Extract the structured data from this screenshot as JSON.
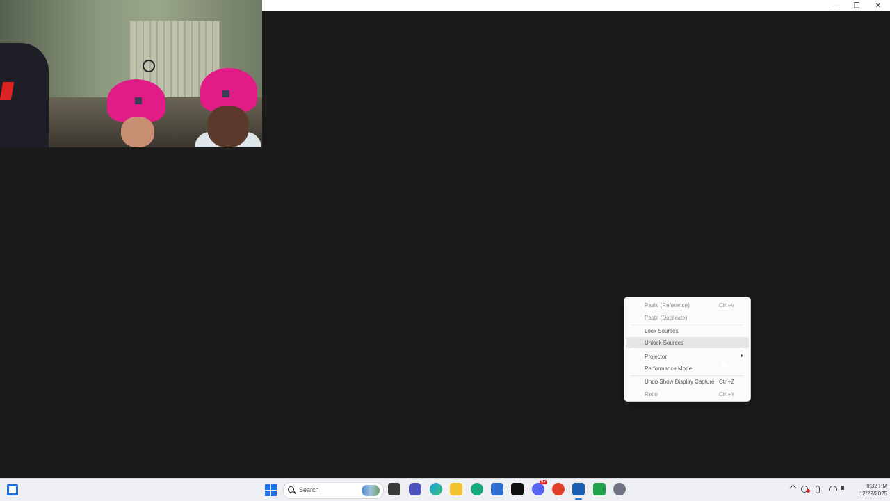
{
  "window": {
    "minimize_glyph": "—",
    "maximize_glyph": "❐",
    "close_glyph": "✕"
  },
  "context_menu": {
    "items": [
      {
        "label": "Paste (Reference)",
        "shortcut": "Ctrl+V",
        "disabled": true
      },
      {
        "label": "Paste (Duplicate)",
        "shortcut": "",
        "disabled": true
      },
      {
        "label": "Lock Sources",
        "shortcut": "",
        "disabled": false
      },
      {
        "label": "Unlock Sources",
        "shortcut": "",
        "disabled": false,
        "highlighted": true
      },
      {
        "label": "Projector",
        "shortcut": "",
        "disabled": false,
        "submenu": true
      },
      {
        "label": "Performance Mode",
        "shortcut": "",
        "disabled": false
      },
      {
        "label": "Undo Show Display Capture",
        "shortcut": "Ctrl+Z",
        "disabled": false
      },
      {
        "label": "Redo",
        "shortcut": "Ctrl+Y",
        "disabled": true
      }
    ]
  },
  "taskbar": {
    "search_label": "Search",
    "apps": [
      "file-explorer-dark-icon",
      "teams-chat-icon",
      "edge-browser-icon",
      "file-explorer-icon",
      "app-green-circle-icon",
      "microsoft-store-icon",
      "terminal-icon",
      "discord-icon",
      "close-app-icon",
      "obs-icon",
      "android-app-icon",
      "settings-gear-icon"
    ],
    "discord_badge": "9+",
    "clock_time": "9:32 PM",
    "clock_date": "12/22/2025"
  },
  "colors": {
    "canvas_background": "#1b1b1b",
    "accent": "#1a73e8",
    "hat_pink": "#e21c87"
  }
}
